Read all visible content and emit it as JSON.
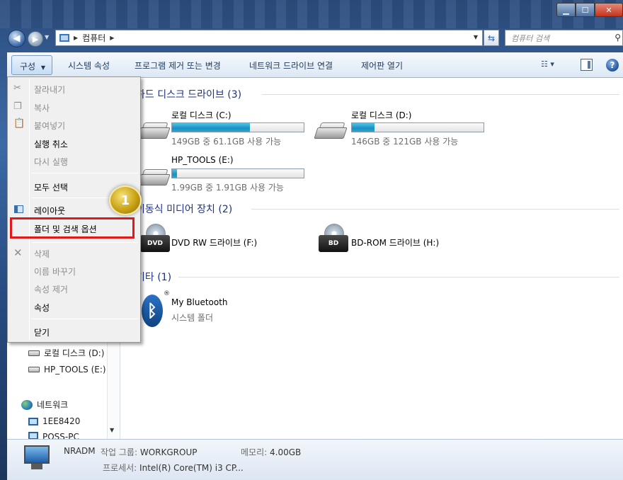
{
  "address": {
    "path": "컴퓨터",
    "search_placeholder": "컴퓨터 검색"
  },
  "toolbar": {
    "organize": "구성",
    "system_properties": "시스템 속성",
    "uninstall": "프로그램 제거 또는 변경",
    "map_drive": "네트워크 드라이브 연결",
    "control_panel": "제어판 열기"
  },
  "groups": {
    "hard_disks": "하드 디스크 드라이브 (3)",
    "removable": "이동식 미디어 장치 (2)",
    "other": "기타 (1)"
  },
  "drives": [
    {
      "name": "로컬 디스크 (C:)",
      "free_text": "149GB 중 61.1GB 사용 가능",
      "used_fraction": 0.59
    },
    {
      "name": "로컬 디스크 (D:)",
      "free_text": "146GB 중 121GB 사용 가능",
      "used_fraction": 0.17
    },
    {
      "name": "HP_TOOLS (E:)",
      "free_text": "1.99GB 중 1.91GB 사용 가능",
      "used_fraction": 0.04
    }
  ],
  "removable_drives": [
    {
      "name": "DVD RW 드라이브 (F:)",
      "badge": "DVD"
    },
    {
      "name": "BD-ROM 드라이브 (H:)",
      "badge": "BD"
    }
  ],
  "other_items": [
    {
      "name": "My Bluetooth",
      "subtitle": "시스템 폴더",
      "mark": "®"
    }
  ],
  "nav": {
    "items": [
      {
        "label": "로컬 디스크 (D:)"
      },
      {
        "label": "HP_TOOLS (E:)"
      },
      {
        "label": "네트워크"
      },
      {
        "label": "1EE8420"
      },
      {
        "label": "POSS-PC"
      }
    ]
  },
  "menu": {
    "items": [
      {
        "label": "잘라내기"
      },
      {
        "label": "복사"
      },
      {
        "label": "붙여넣기"
      },
      {
        "label": "실행 취소"
      },
      {
        "label": "다시 실행"
      },
      {
        "label": "모두 선택"
      },
      {
        "label": "레이아웃"
      },
      {
        "label": "폴더 및 검색 옵션"
      },
      {
        "label": "삭제"
      },
      {
        "label": "이름 바꾸기"
      },
      {
        "label": "속성 제거"
      },
      {
        "label": "속성"
      },
      {
        "label": "닫기"
      }
    ]
  },
  "step_badge": "1",
  "details": {
    "name": "NRADM",
    "workgroup_label": "작업 그룹:",
    "workgroup_value": "WORKGROUP",
    "memory_label": "메모리:",
    "memory_value": "4.00GB",
    "processor_label": "프로세서:",
    "processor_value": "Intel(R) Core(TM) i3 CP..."
  },
  "colors": {
    "highlight_border": "#e0191b",
    "drive_bar": "#1b8fc2",
    "group_title": "#1e3287"
  }
}
